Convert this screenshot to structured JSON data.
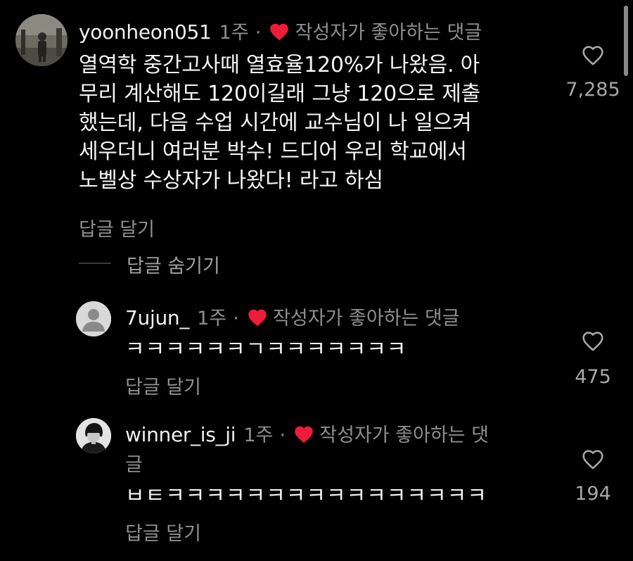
{
  "comments": [
    {
      "username": "yoonheon051",
      "age": "1주",
      "dot": "·",
      "badge": "작성자가 좋아하는 댓글",
      "text": "열역학 중간고사때 열효율120%가 나왔음. 아\n무리 계산해도 120이길래 그냥 120으로 제출\n했는데, 다음 수업 시간에 교수님이 나 일으켜\n세우더니 여러분 박수! 드디어 우리 학교에서\n노벨상 수상자가 나왔다! 라고 하심",
      "reply_label": "답글 달기",
      "likes": "7,285",
      "hide_replies_label": "답글 숨기기"
    }
  ],
  "replies": [
    {
      "username": "7ujun_",
      "age": "1주",
      "dot": "·",
      "badge": "작성자가 좋아하는 댓글",
      "text": "ㅋㅋㅋㅋㅋㅋㄱㅋㅋㅋㅋㅋㅋㅋ",
      "reply_label": "답글 달기",
      "likes": "475"
    },
    {
      "username": "winner_is_ji",
      "age": "1주",
      "dot": "·",
      "badge_line1": "작성자가 좋아하는 댓",
      "badge_line2": "글",
      "text": "ㅂㅌㅋㅋㅋㅋㅋㅋㅋㅋㅋㅋㅋㅋㅋㅋㅋㅋ",
      "reply_label": "답글 달기",
      "likes": "194"
    }
  ],
  "icons": {
    "badge": "heart-filled-icon",
    "like": "heart-outline-icon"
  },
  "colors": {
    "background": "#000000",
    "text": "#f5f5f5",
    "muted": "#8e8e8e",
    "heart": "#ed1c3a"
  }
}
